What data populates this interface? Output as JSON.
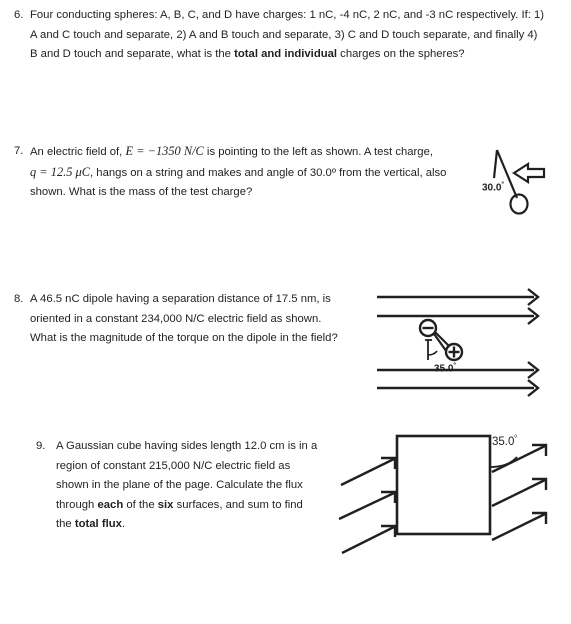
{
  "document": {
    "type": "physics-worksheet",
    "ink_color": "#231f20",
    "background": "#ffffff"
  },
  "questions": [
    {
      "number": "6.",
      "lines": [
        "Four conducting spheres: A, B, C, and D have charges: 1 nC, -4 nC, 2 nC, and -3 nC respectively. If: 1)",
        "A and C touch and separate, 2) A and B touch and separate, 3) C and D touch separate, and finally 4)",
        "B and D touch and separate, what is the total and individual charges on the spheres?"
      ],
      "line3_prefix": "B and D touch and separate, what is the ",
      "line3_bold": "total and individual",
      "line3_suffix": " charges on the spheres?"
    },
    {
      "number": "7.",
      "line1_a": "An electric field of, ",
      "line1_math": "E = −1350 N/C",
      "line1_b": " is pointing to the left as shown. A test charge,",
      "line2_math": "q = 12.5 μC",
      "line2_b": ", hangs on a string and makes and angle of 30.0º from the vertical, also",
      "line3": "shown. What is the mass of the test charge?"
    },
    {
      "number": "8.",
      "lines": [
        "A 46.5 nC dipole having a separation distance of 17.5 nm, is",
        "oriented in a constant 234,000 N/C electric field as shown.",
        "What is the magnitude of the torque on the dipole in the field?"
      ]
    },
    {
      "number": "9.",
      "line1": "A Gaussian cube having sides length 12.0 cm is in a",
      "line2": "region of constant 215,000 N/C electric field as",
      "line3": "shown in the plane of the page. Calculate the flux",
      "line4_a": "through ",
      "line4_bold1": "each",
      "line4_b": " of the ",
      "line4_bold2": "six",
      "line4_c": " surfaces, and sum to find",
      "line5_a": "the ",
      "line5_bold": "total flux",
      "line5_b": "."
    }
  ],
  "figures": {
    "pendulum": {
      "angle_label": "30.0",
      "degree_symbol": "º",
      "description": "hanging charge on string with leftward block arrow"
    },
    "dipole": {
      "angle_label": "35.0",
      "degree_symbol": "º",
      "negative_sign": "−",
      "positive_sign": "+",
      "field_line_count": 4,
      "description": "dipole tilted in uniform rightward field"
    },
    "gaussian_cube": {
      "angle_label": "35.0",
      "degree_symbol": "º",
      "arrow_count_left": 3,
      "arrow_count_right": 3,
      "description": "square with field arrows entering left and exiting right"
    }
  }
}
